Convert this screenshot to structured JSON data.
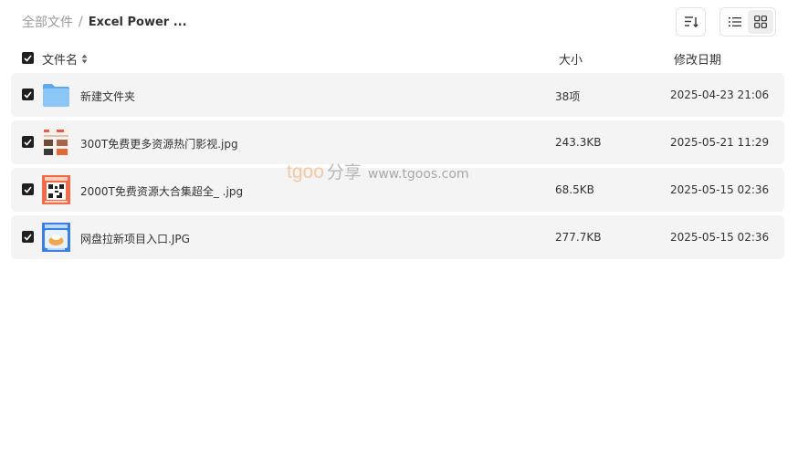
{
  "breadcrumb": {
    "root": "全部文件",
    "separator": "/",
    "current": "Excel Power ..."
  },
  "toolbar": {
    "sort_icon": "sort-icon",
    "list_view_icon": "list-view-icon",
    "grid_view_icon": "grid-view-icon"
  },
  "table": {
    "columns": {
      "name": "文件名",
      "size": "大小",
      "date": "修改日期"
    },
    "rows": [
      {
        "type": "folder",
        "icon": "folder-icon",
        "name": "新建文件夹",
        "size": "38项",
        "date": "2025-04-23 21:06",
        "checked": true
      },
      {
        "type": "image",
        "icon": "image-thumbnail",
        "name": "300T免费更多资源热门影视.jpg",
        "size": "243.3KB",
        "date": "2025-05-21 11:29",
        "checked": true
      },
      {
        "type": "image",
        "icon": "qr-code-thumbnail",
        "name": "2000T免费资源大合集超全_ .jpg",
        "size": "68.5KB",
        "date": "2025-05-15 02:36",
        "checked": true
      },
      {
        "type": "image",
        "icon": "image-thumbnail",
        "name": "网盘拉新项目入口.JPG",
        "size": "277.7KB",
        "date": "2025-05-15 02:36",
        "checked": true
      }
    ]
  },
  "watermark": {
    "latin": "tgoo",
    "chinese": "分享",
    "url": "www.tgoos.com"
  },
  "colors": {
    "row_bg": "#f4f4f4",
    "checkbox": "#1f1f1f",
    "folder": "#7cbcf2",
    "watermark_accent": "#f2c9a3"
  }
}
